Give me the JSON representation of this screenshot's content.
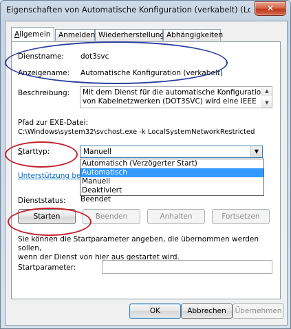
{
  "window": {
    "title": "Eigenschaften von Automatische Konfiguration (verkabelt) (Lokal...",
    "close_glyph": "✕"
  },
  "tabs": [
    {
      "label": "Allgemein",
      "mnemonic": "A",
      "rest": "llgemein"
    },
    {
      "label": "Anmelden"
    },
    {
      "label": "Wiederherstellung"
    },
    {
      "label": "Abhängigkeiten"
    }
  ],
  "general": {
    "service_name_label": "Dienstname:",
    "service_name_value": "dot3svc",
    "display_name_label": "Anzeigename:",
    "display_name_value": "Automatische Konfiguration (verkabelt)",
    "description_label": "Beschreibung:",
    "description_line1": "Mit dem Dienst für die automatische Konfiguration",
    "description_line2": "von Kabelnetzwerken (DOT3SVC) wird eine IEEE",
    "exe_path_label": "Pfad zur EXE-Datei:",
    "exe_path_value": "C:\\Windows\\system32\\svchost.exe -k LocalSystemNetworkRestricted",
    "startup_type_label": "Starttyp:",
    "startup_type_mnemonic": "S",
    "startup_type_rest": "tarttyp:",
    "startup_type_value": "Manuell",
    "startup_options": [
      "Automatisch (Verzögerter Start)",
      "Automatisch",
      "Manuell",
      "Deaktiviert"
    ],
    "highlighted_option": "Automatisch",
    "help_link": "Unterstützung beim",
    "status_label": "Dienststatus:",
    "status_value": "Beendet",
    "start_button": "Starten",
    "stop_button": "Beenden",
    "pause_button": "Anhalten",
    "resume_button": "Fortsetzen",
    "hint_line1": "Sie können die Startparameter angeben, die übernommen werden sollen,",
    "hint_line2": "wenn der Dienst von hier aus gestartet wird.",
    "start_params_label": "Startparameter:",
    "start_params_value": ""
  },
  "footer": {
    "ok": "OK",
    "cancel": "Abbrechen",
    "apply": "Übernehmen"
  },
  "annotations": {
    "blue": "#2a3f9e",
    "red": "#c4202a"
  }
}
